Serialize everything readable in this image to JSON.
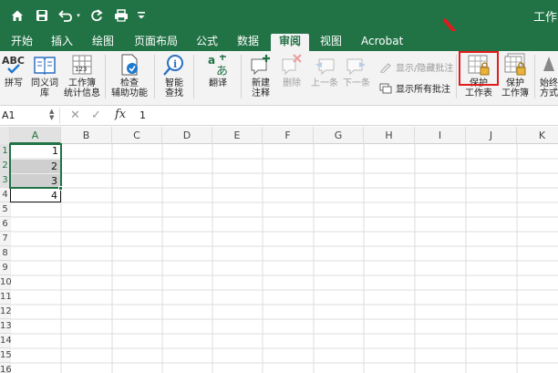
{
  "app": {
    "title_partial": "工作",
    "accent_color": "#217346",
    "highlight_color": "#e21b1b"
  },
  "quick_access": [
    "home-icon",
    "undo-icon",
    "redo-icon",
    "print-icon",
    "customize-icon"
  ],
  "tabs": [
    {
      "label": "开始"
    },
    {
      "label": "插入"
    },
    {
      "label": "绘图"
    },
    {
      "label": "页面布局"
    },
    {
      "label": "公式"
    },
    {
      "label": "数据"
    },
    {
      "label": "审阅",
      "active": true
    },
    {
      "label": "视图"
    },
    {
      "label": "Acrobat"
    }
  ],
  "ribbon": {
    "spelling": "拼写",
    "thesaurus_1": "同义词",
    "thesaurus_2": "库",
    "workbook_stats_1": "工作簿",
    "workbook_stats_2": "统计信息",
    "accessibility_1": "检查",
    "accessibility_2": "辅助功能",
    "smart_lookup_1": "智能",
    "smart_lookup_2": "查找",
    "translate": "翻译",
    "new_comment_1": "新建",
    "new_comment_2": "注释",
    "delete": "删除",
    "previous": "上一条",
    "next": "下一条",
    "show_hide_comment": "显示/隐藏批注",
    "show_all_comments": "显示所有批注",
    "protect_sheet_1": "保护",
    "protect_sheet_2": "工作表",
    "protect_workbook_1": "保护",
    "protect_workbook_2": "工作簿",
    "always_1": "始终",
    "always_2": "方式"
  },
  "formula_bar": {
    "name_box": "A1",
    "fx": "fx",
    "value": "1"
  },
  "columns": [
    "A",
    "B",
    "C",
    "D",
    "E",
    "F",
    "G",
    "H",
    "I",
    "J",
    "K"
  ],
  "rows": [
    "1",
    "2",
    "3",
    "4",
    "5",
    "6",
    "7",
    "8",
    "9",
    "10",
    "11",
    "12",
    "13",
    "14",
    "15",
    "16"
  ],
  "cells": {
    "A1": "1",
    "A2": "2",
    "A3": "3",
    "A4": "4"
  }
}
